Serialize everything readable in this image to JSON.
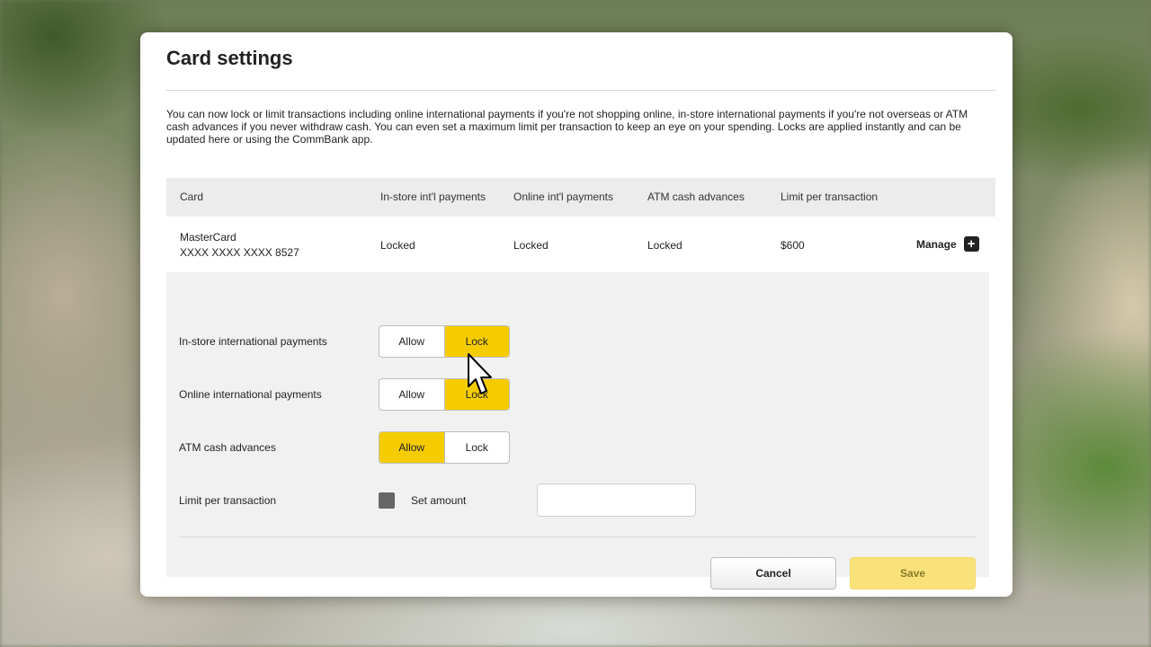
{
  "dialog": {
    "title": "Card settings",
    "intro": "You can now lock or limit transactions including online international payments if you're not shopping online, in-store international payments if you're not overseas or ATM cash advances if you never withdraw cash. You can even set a maximum limit per transaction to keep an eye on your spending. Locks are applied instantly and can be updated here or using the CommBank app."
  },
  "table": {
    "headers": [
      "Card",
      "In-store int'l payments",
      "Online int'l payments",
      "ATM cash advances",
      "Limit per transaction"
    ],
    "row": {
      "card_name": "MasterCard",
      "card_number": "XXXX XXXX XXXX 8527",
      "instore": "Locked",
      "online": "Locked",
      "atm": "Locked",
      "limit": "$600",
      "manage_label": "Manage",
      "manage_icon": "plus-icon"
    }
  },
  "settings": {
    "instore": {
      "label": "In-store international payments",
      "allow": "Allow",
      "lock": "Lock",
      "selected": "lock"
    },
    "online": {
      "label": "Online international payments",
      "allow": "Allow",
      "lock": "Lock",
      "selected": "lock"
    },
    "atm": {
      "label": "ATM cash advances",
      "allow": "Allow",
      "lock": "Lock",
      "selected": "allow"
    },
    "limit": {
      "label": "Limit per transaction",
      "checkbox_label": "Set amount",
      "amount_value": ""
    }
  },
  "buttons": {
    "cancel": "Cancel",
    "save": "Save"
  },
  "colors": {
    "accent": "#f5cc00",
    "save_disabled": "#f9e27a",
    "header_bg": "#ececec",
    "panel_bg": "#f1f1f1"
  }
}
